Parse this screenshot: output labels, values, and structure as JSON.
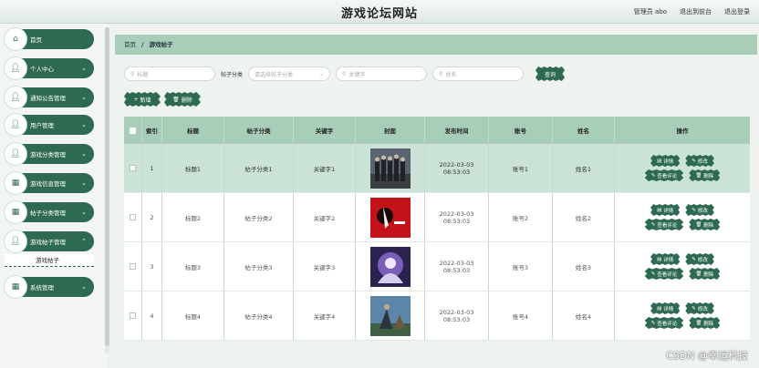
{
  "header": {
    "title": "游戏论坛网站",
    "user_label": "管理员 abo",
    "back_label": "退出到前台",
    "logout_label": "退出登录"
  },
  "sidebar": {
    "items": [
      {
        "label": "首页",
        "icon": "gear-icon"
      },
      {
        "label": "个人中心",
        "icon": "user-icon"
      },
      {
        "label": "通知公告管理",
        "icon": "user-icon"
      },
      {
        "label": "用户管理",
        "icon": "user-icon"
      },
      {
        "label": "游戏分类管理",
        "icon": "user-icon"
      },
      {
        "label": "游戏信息管理",
        "icon": "grid-icon"
      },
      {
        "label": "帖子分类管理",
        "icon": "grid-icon"
      },
      {
        "label": "游戏帖子管理",
        "icon": "user-icon"
      },
      {
        "label": "系统管理",
        "icon": "grid-icon"
      }
    ],
    "active_sub": "游戏帖子"
  },
  "breadcrumb": {
    "home": "首页",
    "separator": "/",
    "current": "游戏帖子"
  },
  "search": {
    "title_placeholder": "标题",
    "category_label": "帖子分类",
    "category_placeholder": "请选择帖子分类",
    "keyword_placeholder": "关键字",
    "name_placeholder": "姓名",
    "search_button": "查询"
  },
  "actions": {
    "add": "新增",
    "delete": "删除"
  },
  "table": {
    "headers": [
      "索引",
      "标题",
      "帖子分类",
      "关键字",
      "封面",
      "发布时间",
      "账号",
      "姓名",
      "操作"
    ],
    "rows": [
      {
        "index": "1",
        "title": "标题1",
        "category": "帖子分类1",
        "keyword": "关键字1",
        "time": "2022-03-03 08:53:03",
        "account": "账号1",
        "name": "姓名1"
      },
      {
        "index": "2",
        "title": "标题2",
        "category": "帖子分类2",
        "keyword": "关键字2",
        "time": "2022-03-03 08:53:03",
        "account": "账号2",
        "name": "姓名2"
      },
      {
        "index": "3",
        "title": "标题3",
        "category": "帖子分类3",
        "keyword": "关键字3",
        "time": "2022-03-03 08:53:03",
        "account": "账号3",
        "name": "姓名3"
      },
      {
        "index": "4",
        "title": "标题4",
        "category": "帖子分类4",
        "keyword": "关键字4",
        "time": "2022-03-03 08:53:03",
        "account": "账号4",
        "name": "姓名4"
      }
    ],
    "ops": {
      "detail": "详情",
      "edit": "修改",
      "comments": "查看评论",
      "delete": "删除"
    }
  },
  "colors": {
    "primary": "#2e6a52",
    "header_bg": "#a8cdb9",
    "row_highlight": "#cbe3d6"
  },
  "watermark": "CSDN @幸运科技"
}
